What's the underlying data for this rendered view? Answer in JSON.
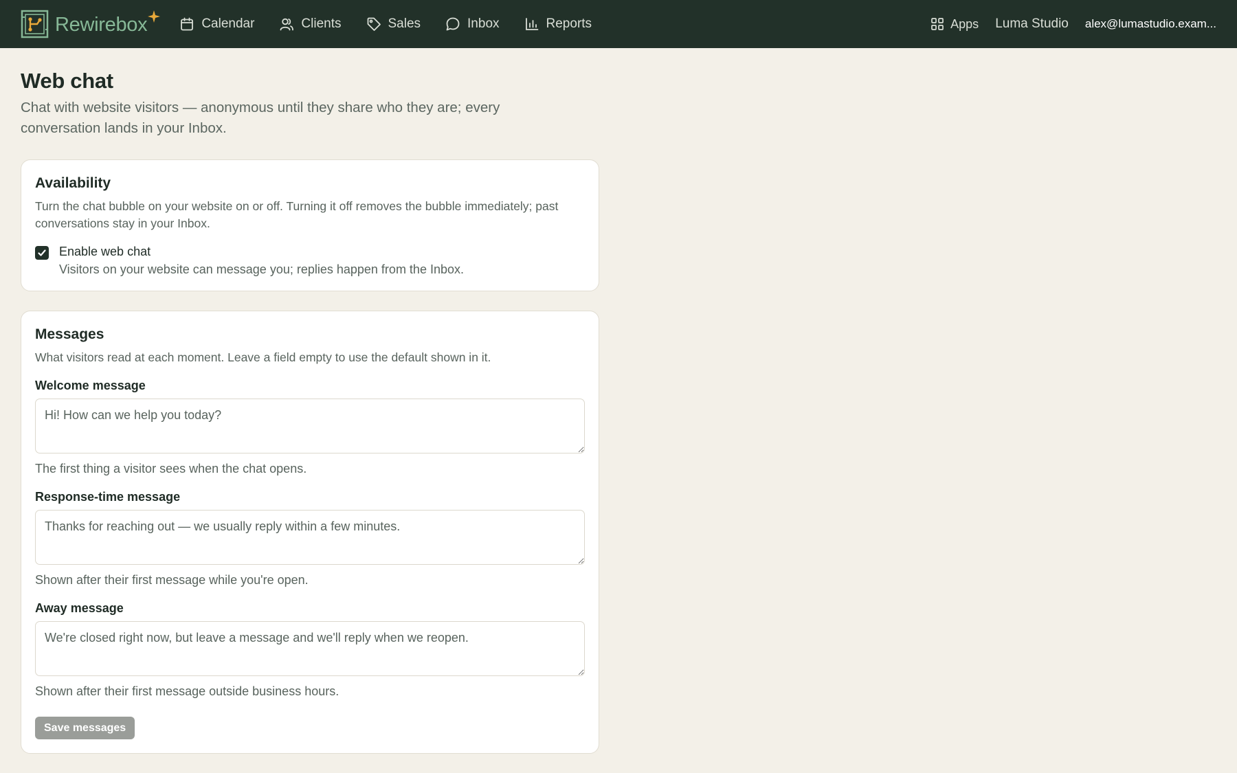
{
  "header": {
    "brand": "Rewirebox",
    "nav": [
      {
        "label": "Calendar",
        "icon": "calendar-icon"
      },
      {
        "label": "Clients",
        "icon": "users-icon"
      },
      {
        "label": "Sales",
        "icon": "tag-icon"
      },
      {
        "label": "Inbox",
        "icon": "chat-bubble-icon"
      },
      {
        "label": "Reports",
        "icon": "bar-chart-icon"
      }
    ],
    "apps_label": "Apps",
    "studio_name": "Luma Studio",
    "account": "alex@lumastudio.exam..."
  },
  "page": {
    "title": "Web chat",
    "subtitle": "Chat with website visitors — anonymous until they share who they are; every conversation lands in your Inbox."
  },
  "availability": {
    "title": "Availability",
    "description": "Turn the chat bubble on your website on or off. Turning it off removes the bubble immediately; past conversations stay in your Inbox.",
    "enable_label": "Enable web chat",
    "enable_help": "Visitors on your website can message you; replies happen from the Inbox.",
    "enabled": true
  },
  "messages": {
    "title": "Messages",
    "description": "What visitors read at each moment. Leave a field empty to use the default shown in it.",
    "fields": [
      {
        "label": "Welcome message",
        "placeholder": "Hi! How can we help you today?",
        "help": "The first thing a visitor sees when the chat opens."
      },
      {
        "label": "Response-time message",
        "placeholder": "Thanks for reaching out — we usually reply within a few minutes.",
        "help": "Shown after their first message while you're open."
      },
      {
        "label": "Away message",
        "placeholder": "We're closed right now, but leave a message and we'll reply when we reopen.",
        "help": "Shown after their first message outside business hours."
      }
    ],
    "save_label": "Save messages"
  },
  "colors": {
    "topbar": "#223129",
    "brand": "#87b897",
    "accent_spark": "#e8a93a",
    "background": "#f3f0e8"
  }
}
